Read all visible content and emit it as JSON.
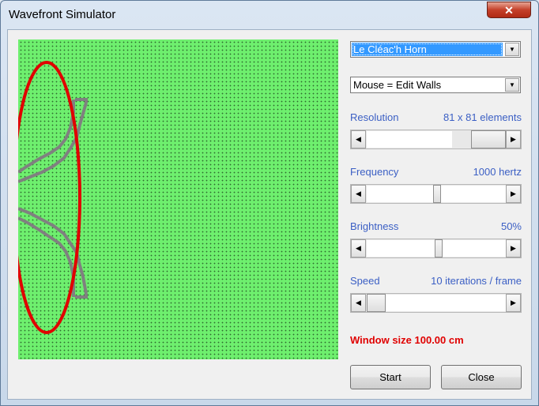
{
  "window": {
    "title": "Wavefront Simulator",
    "close_glyph": "✕"
  },
  "controls": {
    "preset": "Le Cléac'h Horn",
    "mouse_mode": "Mouse = Edit Walls",
    "dropdown_glyph": "▼"
  },
  "resolution": {
    "label": "Resolution",
    "value": "81 x 81 elements",
    "level": 0.7
  },
  "frequency": {
    "label": "Frequency",
    "value": "1000 hertz",
    "level": 0.5
  },
  "brightness": {
    "label": "Brightness",
    "value": "50%",
    "level": 0.5
  },
  "speed": {
    "label": "Speed",
    "value": "10 iterations / frame",
    "level": 0.05
  },
  "window_size": "Window size 100.00 cm",
  "buttons": {
    "start": "Start",
    "close": "Close"
  },
  "arrows": {
    "left": "◀",
    "right": "▶"
  },
  "colors": {
    "field": "#6eef6e",
    "wall": "#808080",
    "annotation": "#e00000",
    "accent": "#3b5fc4"
  }
}
